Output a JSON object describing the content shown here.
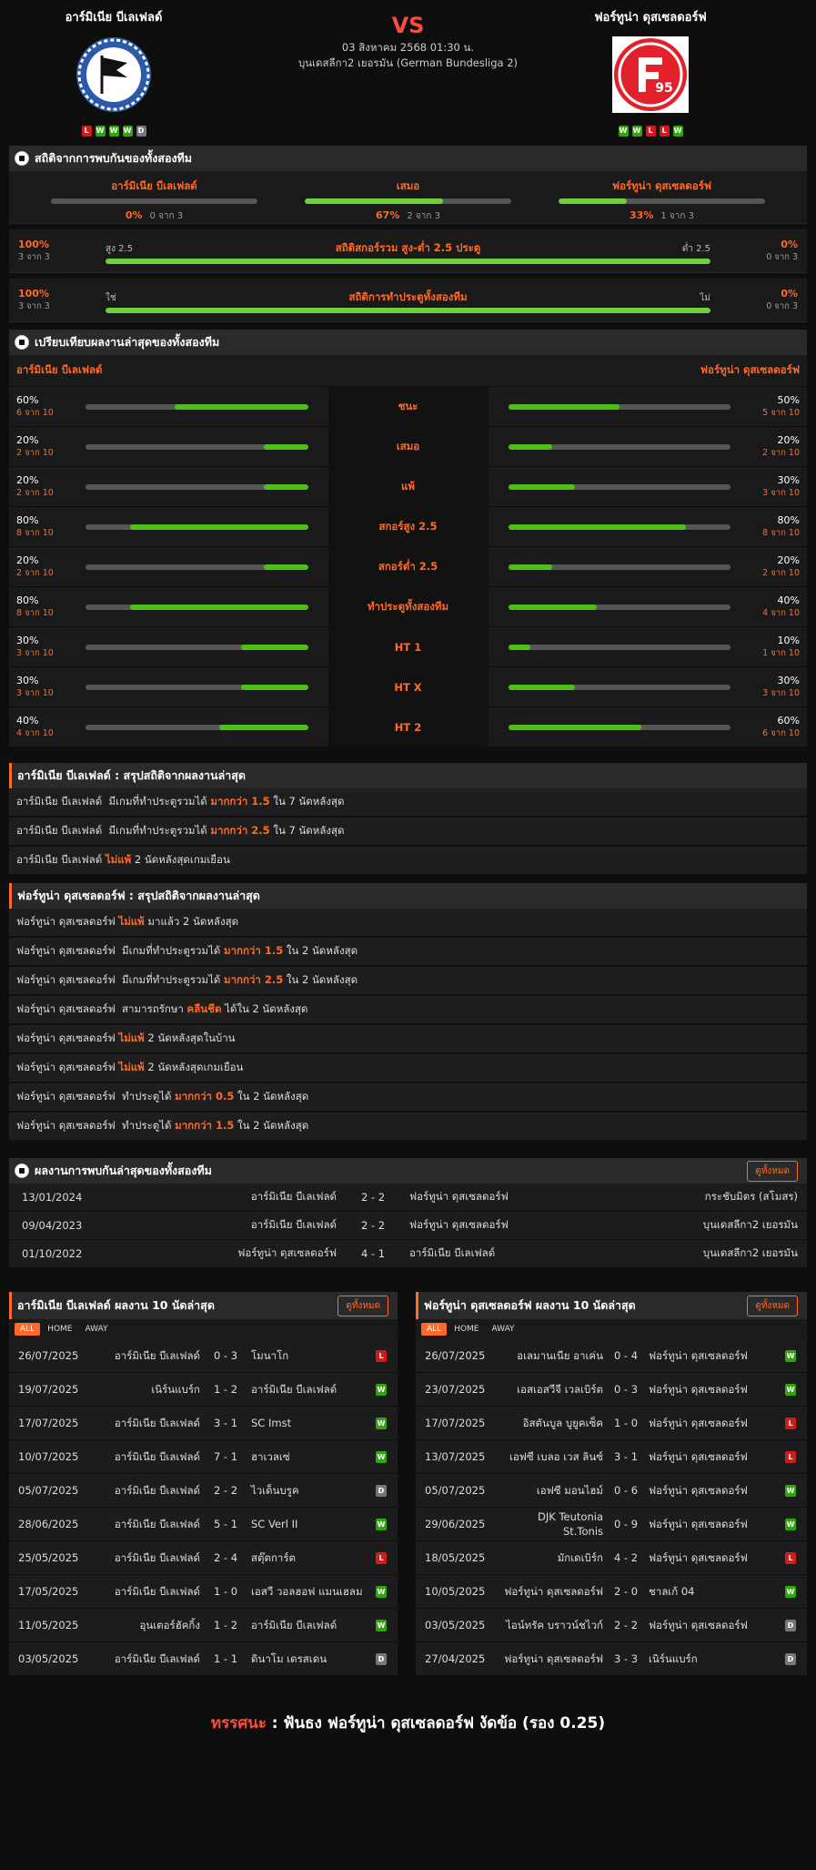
{
  "match": {
    "home": "อาร์มิเนีย บีเลเฟลด์",
    "away": "ฟอร์ทูน่า ดุสเซลดอร์ฟ",
    "vs": "VS",
    "datetime": "03 สิงหาคม 2568 01:30 น.",
    "league": "บุนเดสลีกา2 เยอรมัน (German Bundesliga 2)",
    "home_form": [
      "L",
      "W",
      "W",
      "W",
      "D"
    ],
    "away_form": [
      "W",
      "W",
      "L",
      "L",
      "W"
    ],
    "home_logo_text": "",
    "away_logo_text": "95"
  },
  "h2h_stats": {
    "title": "สถิติจากการพบกันของทั้งสองทีม",
    "cols": [
      {
        "label": "อาร์มิเนีย บีเลเฟลด์",
        "pct": "0%",
        "sub": "0 จาก 3",
        "fill": 0
      },
      {
        "label": "เสมอ",
        "pct": "67%",
        "sub": "2 จาก 3",
        "fill": 0.67
      },
      {
        "label": "ฟอร์ทูน่า ดุสเซลดอร์ฟ",
        "pct": "33%",
        "sub": "1 จาก 3",
        "fill": 0.33
      }
    ],
    "ou": [
      {
        "lp": "100%",
        "ls": "3 จาก 3",
        "label": "สถิติสกอร์รวม สูง-ต่ำ 2.5 ประตู",
        "sl": "สูง 2.5",
        "sr": "ต่ำ 2.5",
        "rp": "0%",
        "rs": "0 จาก 3",
        "fill": 1
      },
      {
        "lp": "100%",
        "ls": "3 จาก 3",
        "label": "สถิติการทำประตูทั้งสองทีม",
        "sl": "ใช่",
        "sr": "ไม่",
        "rp": "0%",
        "rs": "0 จาก 3",
        "fill": 1
      }
    ]
  },
  "compare": {
    "title": "เปรียบเทียบผลงานล่าสุดของทั้งสองทีม",
    "home": "อาร์มิเนีย บีเลเฟลด์",
    "away": "ฟอร์ทูน่า ดุสเซลดอร์ฟ",
    "rows": [
      {
        "label": "ชนะ",
        "hp": "60%",
        "hs": "6 จาก 10",
        "hf": 0.6,
        "ap": "50%",
        "as": "5 จาก 10",
        "af": 0.5
      },
      {
        "label": "เสมอ",
        "hp": "20%",
        "hs": "2 จาก 10",
        "hf": 0.2,
        "ap": "20%",
        "as": "2 จาก 10",
        "af": 0.2
      },
      {
        "label": "แพ้",
        "hp": "20%",
        "hs": "2 จาก 10",
        "hf": 0.2,
        "ap": "30%",
        "as": "3 จาก 10",
        "af": 0.3
      },
      {
        "label": "สกอร์สูง 2.5",
        "hp": "80%",
        "hs": "8 จาก 10",
        "hf": 0.8,
        "ap": "80%",
        "as": "8 จาก 10",
        "af": 0.8
      },
      {
        "label": "สกอร์ต่ำ 2.5",
        "hp": "20%",
        "hs": "2 จาก 10",
        "hf": 0.2,
        "ap": "20%",
        "as": "2 จาก 10",
        "af": 0.2
      },
      {
        "label": "ทำประตูทั้งสองทีม",
        "hp": "80%",
        "hs": "8 จาก 10",
        "hf": 0.8,
        "ap": "40%",
        "as": "4 จาก 10",
        "af": 0.4
      },
      {
        "label": "HT 1",
        "hp": "30%",
        "hs": "3 จาก 10",
        "hf": 0.3,
        "ap": "10%",
        "as": "1 จาก 10",
        "af": 0.1
      },
      {
        "label": "HT X",
        "hp": "30%",
        "hs": "3 จาก 10",
        "hf": 0.3,
        "ap": "30%",
        "as": "3 จาก 10",
        "af": 0.3
      },
      {
        "label": "HT 2",
        "hp": "40%",
        "hs": "4 จาก 10",
        "hf": 0.4,
        "ap": "60%",
        "as": "6 จาก 10",
        "af": 0.6
      }
    ]
  },
  "home_summary": {
    "title": "อาร์มิเนีย บีเลเฟลด์ : สรุปสถิติจากผลงานล่าสุด",
    "rows": [
      [
        "อาร์มิเนีย บีเลเฟลด์  มีเกมที่ทำประตูรวมได้ ",
        "มากกว่า 1.5",
        " ใน 7 นัดหลังสุด"
      ],
      [
        "อาร์มิเนีย บีเลเฟลด์  มีเกมที่ทำประตูรวมได้ ",
        "มากกว่า 2.5",
        " ใน 7 นัดหลังสุด"
      ],
      [
        "อาร์มิเนีย บีเลเฟลด์ ",
        "ไม่แพ้",
        " 2 นัดหลังสุดเกมเยือน"
      ]
    ]
  },
  "away_summary": {
    "title": "ฟอร์ทูน่า ดุสเซลดอร์ฟ : สรุปสถิติจากผลงานล่าสุด",
    "rows": [
      [
        "ฟอร์ทูน่า ดุสเซลดอร์ฟ ",
        "ไม่แพ้",
        " มาแล้ว 2 นัดหลังสุด"
      ],
      [
        "ฟอร์ทูน่า ดุสเซลดอร์ฟ  มีเกมที่ทำประตูรวมได้ ",
        "มากกว่า 1.5",
        " ใน 2 นัดหลังสุด"
      ],
      [
        "ฟอร์ทูน่า ดุสเซลดอร์ฟ  มีเกมที่ทำประตูรวมได้ ",
        "มากกว่า 2.5",
        " ใน 2 นัดหลังสุด"
      ],
      [
        "ฟอร์ทูน่า ดุสเซลดอร์ฟ  สามารถรักษา ",
        "คลีนชีต",
        " ได้ใน 2 นัดหลังสุด"
      ],
      [
        "ฟอร์ทูน่า ดุสเซลดอร์ฟ ",
        "ไม่แพ้",
        " 2 นัดหลังสุดในบ้าน"
      ],
      [
        "ฟอร์ทูน่า ดุสเซลดอร์ฟ ",
        "ไม่แพ้",
        " 2 นัดหลังสุดเกมเยือน"
      ],
      [
        "ฟอร์ทูน่า ดุสเซลดอร์ฟ  ทำประตูได้ ",
        "มากกว่า 0.5",
        " ใน 2 นัดหลังสุด"
      ],
      [
        "ฟอร์ทูน่า ดุสเซลดอร์ฟ  ทำประตูได้ ",
        "มากกว่า 1.5",
        " ใน 2 นัดหลังสุด"
      ]
    ]
  },
  "h2h_list": {
    "title": "ผลงานการพบกันล่าสุดของทั้งสองทีม",
    "btn": "ดูทั้งหมด",
    "rows": [
      [
        "13/01/2024",
        "อาร์มิเนีย บีเลเฟลด์",
        "2 - 2",
        "ฟอร์ทูน่า ดุสเซลดอร์ฟ",
        "กระชับมิตร (สโมสร)"
      ],
      [
        "09/04/2023",
        "อาร์มิเนีย บีเลเฟลด์",
        "2 - 2",
        "ฟอร์ทูน่า ดุสเซลดอร์ฟ",
        "บุนเดสลีกา2 เยอรมัน"
      ],
      [
        "01/10/2022",
        "ฟอร์ทูน่า ดุสเซลดอร์ฟ",
        "4 - 1",
        "อาร์มิเนีย บีเลเฟลด์",
        "บุนเดสลีกา2 เยอรมัน"
      ]
    ]
  },
  "tabs": [
    "ALL",
    "HOME",
    "AWAY"
  ],
  "home_last10": {
    "title": "อาร์มิเนีย บีเลเฟลด์ ผลงาน 10 นัดล่าสุด",
    "btn": "ดูทั้งหมด",
    "rows": [
      [
        "26/07/2025",
        "อาร์มิเนีย บีเลเฟลด์",
        "0 - 3",
        "โมนาโก",
        "L"
      ],
      [
        "19/07/2025",
        "เนิร์นแบร์ก",
        "1 - 2",
        "อาร์มิเนีย บีเลเฟลด์",
        "W"
      ],
      [
        "17/07/2025",
        "อาร์มิเนีย บีเลเฟลด์",
        "3 - 1",
        "SC Imst",
        "W"
      ],
      [
        "10/07/2025",
        "อาร์มิเนีย บีเลเฟลด์",
        "7 - 1",
        "ฮาเวลเซ่",
        "W"
      ],
      [
        "05/07/2025",
        "อาร์มิเนีย บีเลเฟลด์",
        "2 - 2",
        "ไวเด็นบรูค",
        "D"
      ],
      [
        "28/06/2025",
        "อาร์มิเนีย บีเลเฟลด์",
        "5 - 1",
        "SC Verl II",
        "W"
      ],
      [
        "25/05/2025",
        "อาร์มิเนีย บีเลเฟลด์",
        "2 - 4",
        "สตุ๊ตการ์ต",
        "L"
      ],
      [
        "17/05/2025",
        "อาร์มิเนีย บีเลเฟลด์",
        "1 - 0",
        "เอสวี วอลฮอฟ แมนเฮลม",
        "W"
      ],
      [
        "11/05/2025",
        "อุนเตอร์ฮัคกิ้ง",
        "1 - 2",
        "อาร์มิเนีย บีเลเฟลด์",
        "W"
      ],
      [
        "03/05/2025",
        "อาร์มิเนีย บีเลเฟลด์",
        "1 - 1",
        "ดินาโม เดรสเดน",
        "D"
      ]
    ]
  },
  "away_last10": {
    "title": "ฟอร์ทูน่า ดุสเซลดอร์ฟ ผลงาน 10 นัดล่าสุด",
    "btn": "ดูทั้งหมด",
    "rows": [
      [
        "26/07/2025",
        "อเลมานเนีย อาเค่น",
        "0 - 4",
        "ฟอร์ทูน่า ดุสเซลดอร์ฟ",
        "W"
      ],
      [
        "23/07/2025",
        "เอสเอสวีจี เวลเบิร์ต",
        "0 - 3",
        "ฟอร์ทูน่า ดุสเซลดอร์ฟ",
        "W"
      ],
      [
        "17/07/2025",
        "อิสตันบูล บูยูคเซ็ค",
        "1 - 0",
        "ฟอร์ทูน่า ดุสเซลดอร์ฟ",
        "L"
      ],
      [
        "13/07/2025",
        "เอฟซี เบลอ เวส ลินซ์",
        "3 - 1",
        "ฟอร์ทูน่า ดุสเซลดอร์ฟ",
        "L"
      ],
      [
        "05/07/2025",
        "เอฟซี มอนไฮม์",
        "0 - 6",
        "ฟอร์ทูน่า ดุสเซลดอร์ฟ",
        "W"
      ],
      [
        "29/06/2025",
        "DJK Teutonia St.Tonis",
        "0 - 9",
        "ฟอร์ทูน่า ดุสเซลดอร์ฟ",
        "W"
      ],
      [
        "18/05/2025",
        "มักเดเบิร์ก",
        "4 - 2",
        "ฟอร์ทูน่า ดุสเซลดอร์ฟ",
        "L"
      ],
      [
        "10/05/2025",
        "ฟอร์ทูน่า ดุสเซลดอร์ฟ",
        "2 - 0",
        "ชาลเก้ 04",
        "W"
      ],
      [
        "03/05/2025",
        "ไอน์ทรัค บราวน์ชไวก์",
        "2 - 2",
        "ฟอร์ทูน่า ดุสเซลดอร์ฟ",
        "D"
      ],
      [
        "27/04/2025",
        "ฟอร์ทูน่า ดุสเซลดอร์ฟ",
        "3 - 3",
        "เนิร์นแบร์ก",
        "D"
      ]
    ]
  },
  "verdict": {
    "label": "ทรรศนะ",
    "text": " :  ฟันธง ฟอร์ทูน่า ดุสเซลดอร์ฟ งัดข้อ (รอง 0.25)"
  },
  "colors": {
    "accent": "#ff6a2a",
    "win": "#2fa70b",
    "loss": "#d21a1a",
    "draw": "#777777",
    "bar": "#4cc014"
  }
}
